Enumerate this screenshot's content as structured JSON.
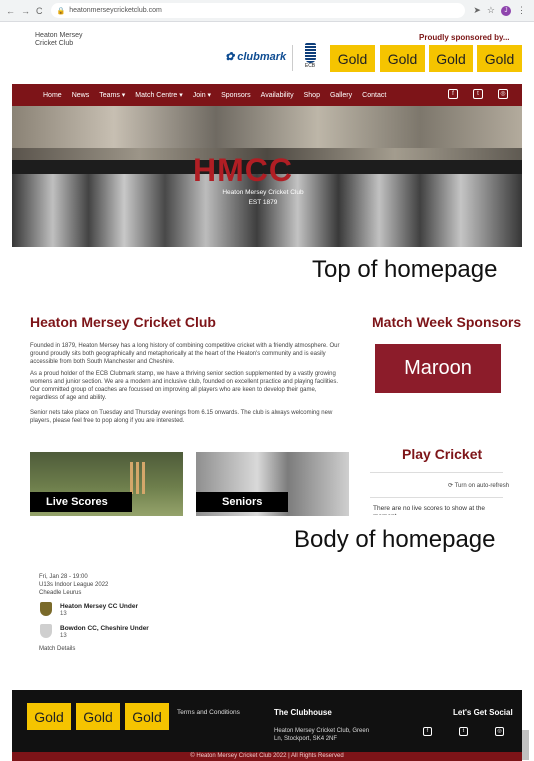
{
  "browser": {
    "url": "heatonmerseycricketclub.com"
  },
  "header": {
    "logo_alt": "Heaton Mersey Cricket Club",
    "sponsor_heading": "Proudly sponsored by...",
    "clubmark": "clubmark",
    "ecb": "ECB",
    "gold_labels": [
      "Gold",
      "Gold",
      "Gold",
      "Gold"
    ]
  },
  "nav": {
    "items": [
      "Home",
      "News",
      "Teams ▾",
      "Match Centre ▾",
      "Join ▾",
      "Sponsors",
      "Availability",
      "Shop",
      "Gallery",
      "Contact"
    ]
  },
  "hero": {
    "title": "HMCC",
    "subtitle": "Heaton Mersey Cricket Club",
    "established": "EST 1879"
  },
  "captions": {
    "top": "Top of homepage",
    "body": "Body of homepage"
  },
  "main": {
    "title": "Heaton Mersey Cricket Club",
    "paragraphs": [
      "Founded in 1879, Heaton Mersey has a long history of combining competitive cricket with a friendly atmosphere. Our ground proudly sits both geographically and metaphorically at the heart of the Heaton's community and is easily accessible from both South Manchester and Cheshire.",
      "As a proud holder of the ECB Clubmark stamp, we have a thriving senior section supplemented by a vastly growing womens and junior section. We are a modern and inclusive club, founded on excellent practice and playing facilities. Our committed group of coaches are focussed on improving all players who are keen to develop their game, regardless of age and ability.",
      "Senior nets take place on Tuesday and Thursday evenings from 6.15 onwards. The club is always welcoming new players, please feel free to pop along if you are interested."
    ],
    "cards": [
      "Live Scores",
      "Seniors"
    ]
  },
  "sidebar": {
    "sponsors_title": "Match Week Sponsors",
    "sponsor_name": "Maroon",
    "play_cricket_title": "Play Cricket",
    "auto_refresh": "Turn on auto-refresh",
    "no_scores": "There are no live scores to show at the moment"
  },
  "match": {
    "date": "Fri, Jan 28 - 19:00",
    "league": "U13s Indoor League 2022",
    "venue": "Cheadle Leurus",
    "home_team": "Heaton Mersey CC Under",
    "home_score": "13",
    "away_team": "Bowdon CC, Cheshire Under",
    "away_score": "13",
    "details": "Match Details"
  },
  "footer": {
    "gold_labels": [
      "Gold",
      "Gold",
      "Gold"
    ],
    "terms": "Terms and Conditions",
    "clubhouse_title": "The Clubhouse",
    "address": "Heaton Mersey Cricket Club, Green Ln, Stockport, SK4 2NF",
    "social_title": "Let's Get Social",
    "copyright": "© Heaton Mersey Cricket Club 2022 | All Rights Reserved"
  },
  "colors": {
    "maroon": "#7d1418",
    "gold": "#f5c400",
    "footer": "#111111"
  }
}
